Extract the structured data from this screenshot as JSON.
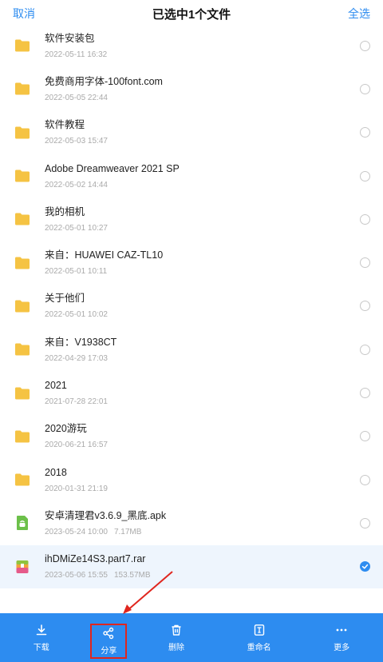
{
  "header": {
    "cancel_label": "取消",
    "title": "已选中1个文件",
    "select_all_label": "全选"
  },
  "files": [
    {
      "name": "软件安装包",
      "date": "2022-05-11  16:32",
      "size": "",
      "type": "folder",
      "selected": false
    },
    {
      "name": "免费商用字体-100font.com",
      "date": "2022-05-05  22:44",
      "size": "",
      "type": "folder",
      "selected": false
    },
    {
      "name": "软件教程",
      "date": "2022-05-03  15:47",
      "size": "",
      "type": "folder",
      "selected": false
    },
    {
      "name": "Adobe Dreamweaver 2021 SP",
      "date": "2022-05-02  14:44",
      "size": "",
      "type": "folder",
      "selected": false
    },
    {
      "name": "我的相机",
      "date": "2022-05-01  10:27",
      "size": "",
      "type": "folder",
      "selected": false
    },
    {
      "name": "来自：HUAWEI CAZ-TL10",
      "date": "2022-05-01  10:11",
      "size": "",
      "type": "folder",
      "selected": false
    },
    {
      "name": "关于他们",
      "date": "2022-05-01  10:02",
      "size": "",
      "type": "folder",
      "selected": false
    },
    {
      "name": "来自：V1938CT",
      "date": "2022-04-29  17:03",
      "size": "",
      "type": "folder",
      "selected": false
    },
    {
      "name": "2021",
      "date": "2021-07-28  22:01",
      "size": "",
      "type": "folder",
      "selected": false
    },
    {
      "name": "2020游玩",
      "date": "2020-06-21  16:57",
      "size": "",
      "type": "folder",
      "selected": false
    },
    {
      "name": "2018",
      "date": "2020-01-31  21:19",
      "size": "",
      "type": "folder",
      "selected": false
    },
    {
      "name": "安卓清理君v3.6.9_黑底.apk",
      "date": "2023-05-24  10:00",
      "size": "7.17MB",
      "type": "apk",
      "selected": false
    },
    {
      "name": "ihDMiZe14S3.part7.rar",
      "date": "2023-05-06  15:55",
      "size": "153.57MB",
      "type": "archive",
      "selected": true
    }
  ],
  "colors": {
    "accent": "#2d8cf0",
    "folder": "#f5c343",
    "apk": "#6cc04a",
    "highlight": "#e0261e"
  },
  "toolbar": {
    "download_label": "下载",
    "share_label": "分享",
    "delete_label": "删除",
    "rename_label": "重命名",
    "more_label": "更多"
  }
}
